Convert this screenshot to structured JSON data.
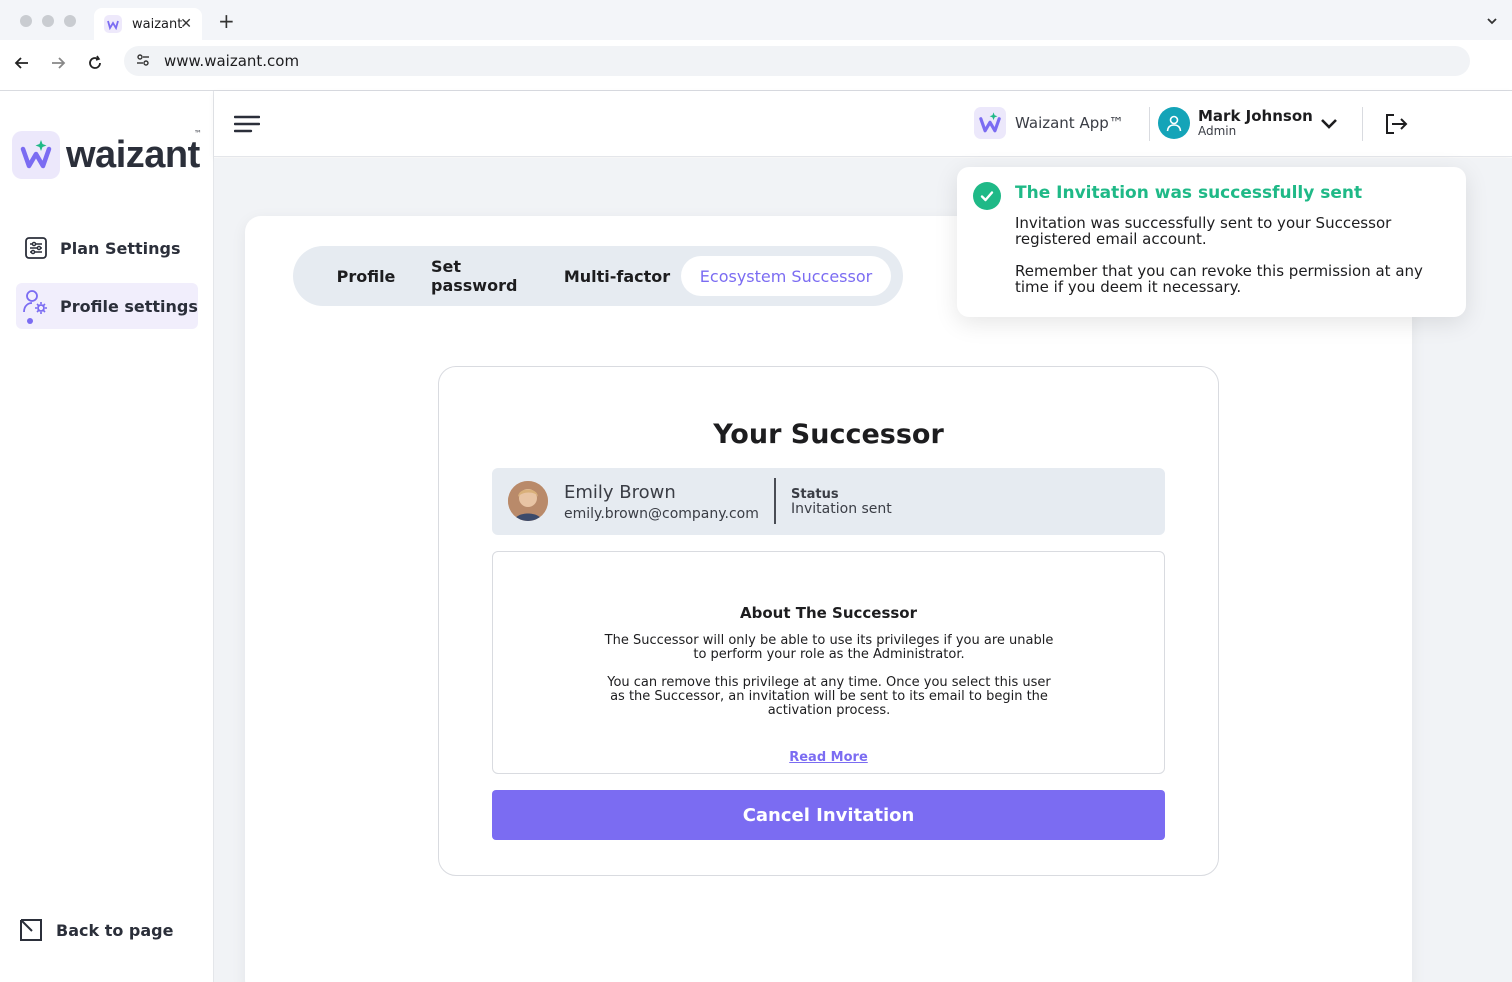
{
  "browser": {
    "tab_title": "waizant",
    "tab_close": "✕",
    "new_tab": "+",
    "url": "www.waizant.com"
  },
  "sidebar": {
    "logo_text": "waizant",
    "logo_tm": "™",
    "items": [
      {
        "label": "Plan Settings",
        "icon": "sliders-icon",
        "active": false
      },
      {
        "label": "Profile settings",
        "icon": "user-gear-icon",
        "active": true
      }
    ],
    "back_label": "Back to page"
  },
  "header": {
    "app_name": "Waizant App™",
    "user_name": "Mark Johnson",
    "user_role": "Admin"
  },
  "tabs": [
    {
      "label": "Profile",
      "active": false
    },
    {
      "label": "Set password",
      "active": false
    },
    {
      "label": "Multi-factor",
      "active": false
    },
    {
      "label": "Ecosystem Successor",
      "active": true
    }
  ],
  "successor": {
    "title": "Your Successor",
    "name": "Emily Brown",
    "email": "emily.brown@company.com",
    "status_label": "Status",
    "status_value": "Invitation sent"
  },
  "about": {
    "title": "About The Successor",
    "paragraph1_line1": "The Successor will only be able to use its privileges if you are unable",
    "paragraph1_line2": "to perform your role as the Administrator.",
    "paragraph2_line1": "You can remove this privilege at any time. Once you select this user",
    "paragraph2_line2": "as the Successor, an invitation will be sent to its email to begin the",
    "paragraph2_line3": "activation process.",
    "read_more": "Read More"
  },
  "actions": {
    "cancel_label": "Cancel Invitation"
  },
  "toast": {
    "title": "The Invitation was successfully sent",
    "line1": "Invitation was successfully sent to your Successor",
    "line2": "registered email account.",
    "line3": "Remember that you can revoke this permission at any",
    "line4": "time if you deem it necessary."
  },
  "colors": {
    "accent": "#7b6cf2",
    "success": "#1fb987",
    "user_avatar": "#14a4b8",
    "panel": "#e6ebf1",
    "background": "#f1f3f6"
  }
}
